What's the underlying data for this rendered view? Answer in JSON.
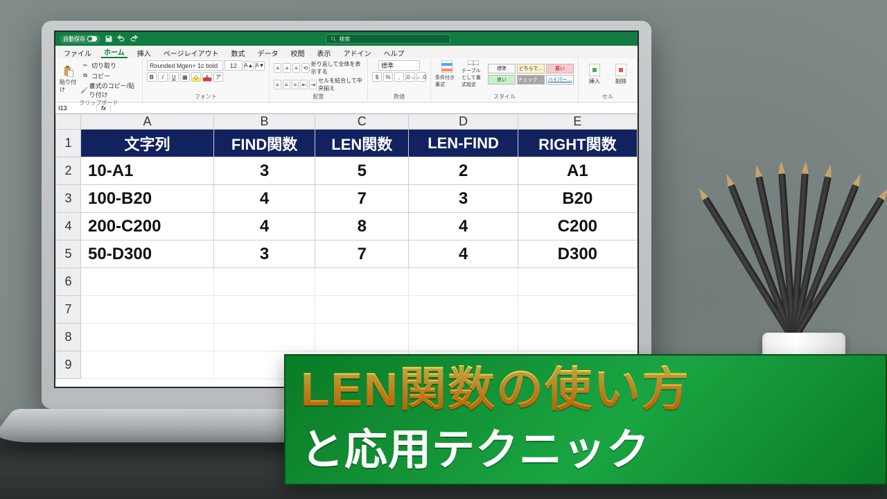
{
  "titlebar": {
    "autosave_label": "自動保存",
    "autosave_state": "オン",
    "search_placeholder": "検索"
  },
  "tabs": {
    "file": "ファイル",
    "home": "ホーム",
    "insert": "挿入",
    "page_layout": "ページレイアウト",
    "formulas": "数式",
    "data": "データ",
    "review": "校閲",
    "view": "表示",
    "addin": "アドイン",
    "help": "ヘルプ"
  },
  "ribbon": {
    "clipboard": {
      "label": "クリップボード",
      "paste": "貼り付け",
      "cut": "切り取り",
      "copy": "コピー",
      "format_painter": "書式のコピー/貼り付け"
    },
    "font": {
      "label": "フォント",
      "name": "Rounded Mgen+ 1c bold",
      "size": "12"
    },
    "alignment": {
      "label": "配置",
      "wrap": "折り返して全体を表示する",
      "merge": "セルを結合して中央揃え"
    },
    "number": {
      "label": "数値",
      "format": "標準"
    },
    "styles": {
      "label": "スタイル",
      "conditional": "条件付き書式",
      "as_table": "テーブルとして書式設定",
      "normal": "標準",
      "dochira": "どちらで…",
      "bad": "悪い",
      "good": "良い",
      "check": "チェック …",
      "hyper": "ハイパー…"
    },
    "cells": {
      "label": "セル",
      "insert": "挿入",
      "delete": "削除"
    }
  },
  "formula_bar": {
    "name_box": "I13",
    "fx_label": "fx",
    "formula": ""
  },
  "sheet": {
    "columns": [
      "A",
      "B",
      "C",
      "D",
      "E"
    ],
    "rows": [
      "1",
      "2",
      "3",
      "4",
      "5",
      "6",
      "7",
      "8",
      "9"
    ],
    "headers": {
      "a": "文字列",
      "b": "FIND関数",
      "c": "LEN関数",
      "d": "LEN-FIND",
      "e": "RIGHT関数"
    },
    "data": [
      {
        "a": "10-A1",
        "b": "3",
        "c": "5",
        "d": "2",
        "e": "A1"
      },
      {
        "a": "100-B20",
        "b": "4",
        "c": "7",
        "d": "3",
        "e": "B20"
      },
      {
        "a": "200-C200",
        "b": "4",
        "c": "8",
        "d": "4",
        "e": "C200"
      },
      {
        "a": "50-D300",
        "b": "3",
        "c": "7",
        "d": "4",
        "e": "D300"
      }
    ]
  },
  "overlay": {
    "line1": "LEN関数の使い方",
    "line2": "と応用テクニック"
  }
}
